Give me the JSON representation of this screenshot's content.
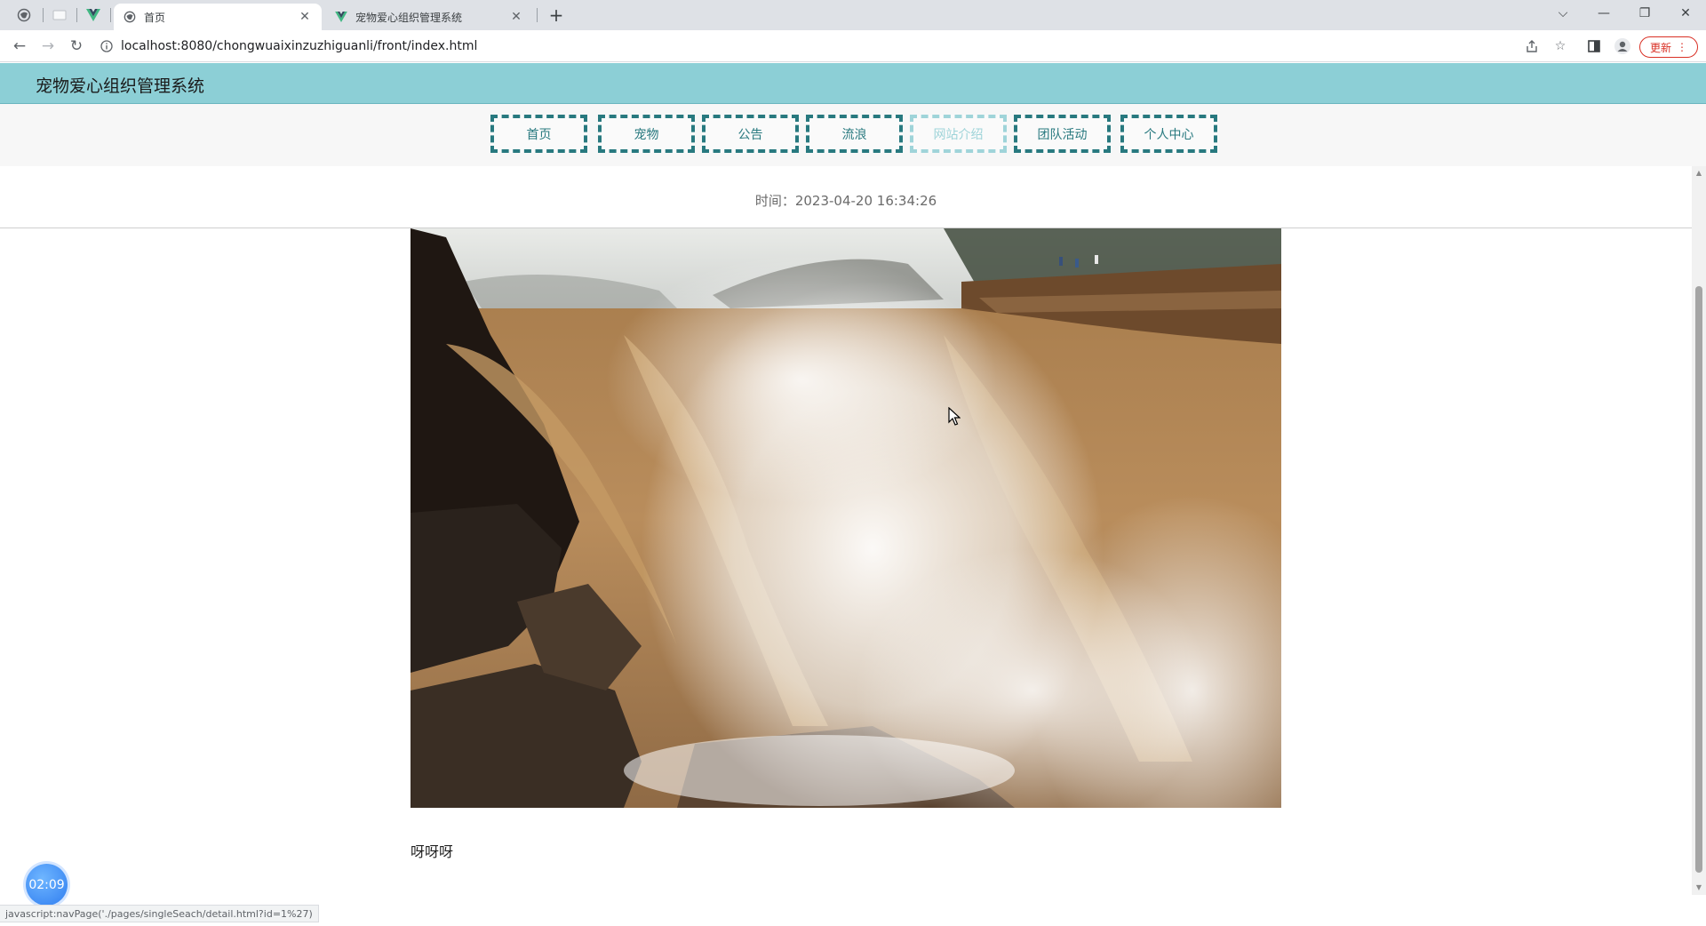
{
  "browser": {
    "tabs": [
      {
        "title": "首页",
        "active": true
      },
      {
        "title": "宠物爱心组织管理系统",
        "active": false
      }
    ],
    "new_tab": "+",
    "url": "localhost:8080/chongwuaixinzuzhiguanli/front/index.html",
    "update_label": "更新",
    "status_text": "javascript:navPage('./pages/singleSeach/detail.html?id=1%27)"
  },
  "site": {
    "title": "宠物爱心组织管理系统",
    "menu": [
      "首页",
      "宠物",
      "公告",
      "流浪",
      "网站介绍",
      "团队活动",
      "个人中心"
    ],
    "active_menu": "网站介绍"
  },
  "article": {
    "time_label": "时间：",
    "time": "2023-04-20 16:34:26",
    "content": "呀呀呀"
  },
  "timer": "02:09",
  "colors": {
    "header_bg": "#8ccfd6",
    "menu_border": "#28797f",
    "menu_active": "#9fd4d9",
    "update_red": "#d93025"
  }
}
